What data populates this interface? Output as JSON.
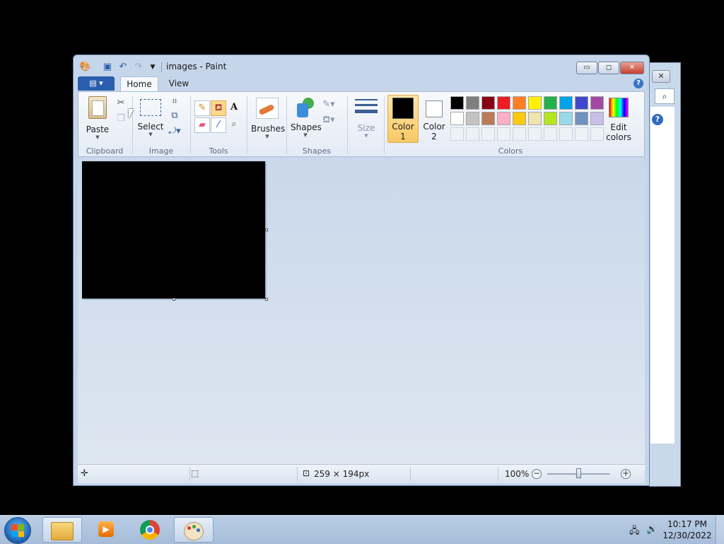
{
  "window": {
    "title": "images - Paint",
    "minimize": "▭",
    "maximize": "◻",
    "close": "✕"
  },
  "ribbon": {
    "tabs": [
      "Home",
      "View"
    ],
    "groups": {
      "clipboard": {
        "label": "Clipboard",
        "paste": "Paste"
      },
      "image": {
        "label": "Image",
        "select": "Select"
      },
      "tools": {
        "label": "Tools"
      },
      "brushes": {
        "label": "Brushes"
      },
      "shapes": {
        "label": "Shapes",
        "shapes_button": "Shapes"
      },
      "size": {
        "label": "Size"
      },
      "colors": {
        "label": "Colors",
        "color1_line1": "Color",
        "color1_line2": "1",
        "color2_line1": "Color",
        "color2_line2": "2",
        "edit_line1": "Edit",
        "edit_line2": "colors",
        "color1_value": "#000000",
        "color2_value": "#ffffff",
        "palette_row1": [
          "#000000",
          "#7f7f7f",
          "#880015",
          "#ed1c24",
          "#ff7f27",
          "#fff200",
          "#22b14c",
          "#00a2e8",
          "#3f48cc",
          "#a349a4"
        ],
        "palette_row2": [
          "#ffffff",
          "#c3c3c3",
          "#b97a57",
          "#ffaec9",
          "#ffc90e",
          "#efe4b0",
          "#b5e61d",
          "#99d9ea",
          "#7092be",
          "#c8bfe7"
        ]
      }
    }
  },
  "status": {
    "image_size": "259 × 194px",
    "zoom": "100%"
  },
  "taskbar": {
    "time": "10:17 PM",
    "date": "12/30/2022"
  }
}
